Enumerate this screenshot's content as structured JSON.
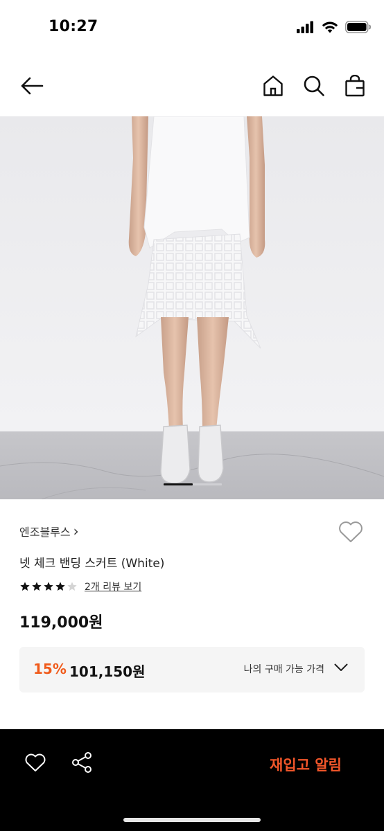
{
  "status_bar": {
    "time": "10:27"
  },
  "nav": {
    "back_icon": "arrow-left-icon",
    "home_icon": "home-icon",
    "search_icon": "search-icon",
    "bag_icon": "shopping-bag-icon"
  },
  "product": {
    "brand": "엔조블루스",
    "brand_chevron": "›",
    "name": "넷 체크 밴딩 스커트 (White)",
    "rating": 4,
    "rating_max": 5,
    "review_link": "2개 리뷰 보기",
    "price": "119,000원",
    "discount_rate": "15%",
    "discount_price": "101,150원",
    "benefit_label": "나의 구매 가능 가격",
    "image_carousel": {
      "current_index": 1,
      "total": 3
    }
  },
  "bottom_bar": {
    "restock_label": "재입고 알림",
    "wish_icon": "heart-outline-icon",
    "share_icon": "share-icon"
  },
  "colors": {
    "accent": "#f05a1a",
    "bottom_bar_bg": "#000000",
    "price_box_bg": "#f5f5f5"
  }
}
